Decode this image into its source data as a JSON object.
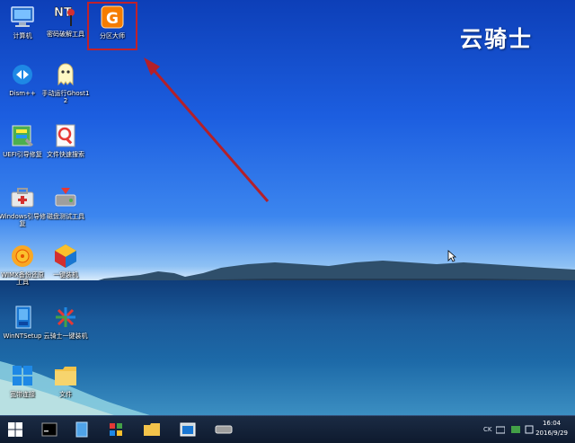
{
  "brand": {
    "text": "云骑士"
  },
  "desktop_icons": [
    {
      "name": "this-pc",
      "label": "计算机"
    },
    {
      "name": "nt-password",
      "label": "密码破解工具"
    },
    {
      "name": "partition-tool",
      "label": "分区大师"
    },
    {
      "name": "dism",
      "label": "Dism++"
    },
    {
      "name": "ghost",
      "label": "手动运行Ghost12"
    },
    {
      "name": "uefi-repair",
      "label": "UEFI引导修复"
    },
    {
      "name": "file-search",
      "label": "文件快速搜索"
    },
    {
      "name": "windows-boot-repair",
      "label": "Windows引导修复"
    },
    {
      "name": "disk-tool",
      "label": "磁盘测试工具"
    },
    {
      "name": "wimx",
      "label": "WIMX备份还原工具"
    },
    {
      "name": "installer",
      "label": "一键装机"
    },
    {
      "name": "winntsetup",
      "label": "WinNTSetup"
    },
    {
      "name": "yunqishi-installer",
      "label": "云骑士一键装机"
    },
    {
      "name": "network",
      "label": "宽带连接"
    },
    {
      "name": "folder",
      "label": "文件"
    }
  ],
  "taskbar": {
    "clock_time": "16:04",
    "clock_date": "2016/9/29",
    "tray_text": "CK"
  },
  "colors": {
    "highlight": "#c0212b",
    "taskbar": "#14233a"
  }
}
